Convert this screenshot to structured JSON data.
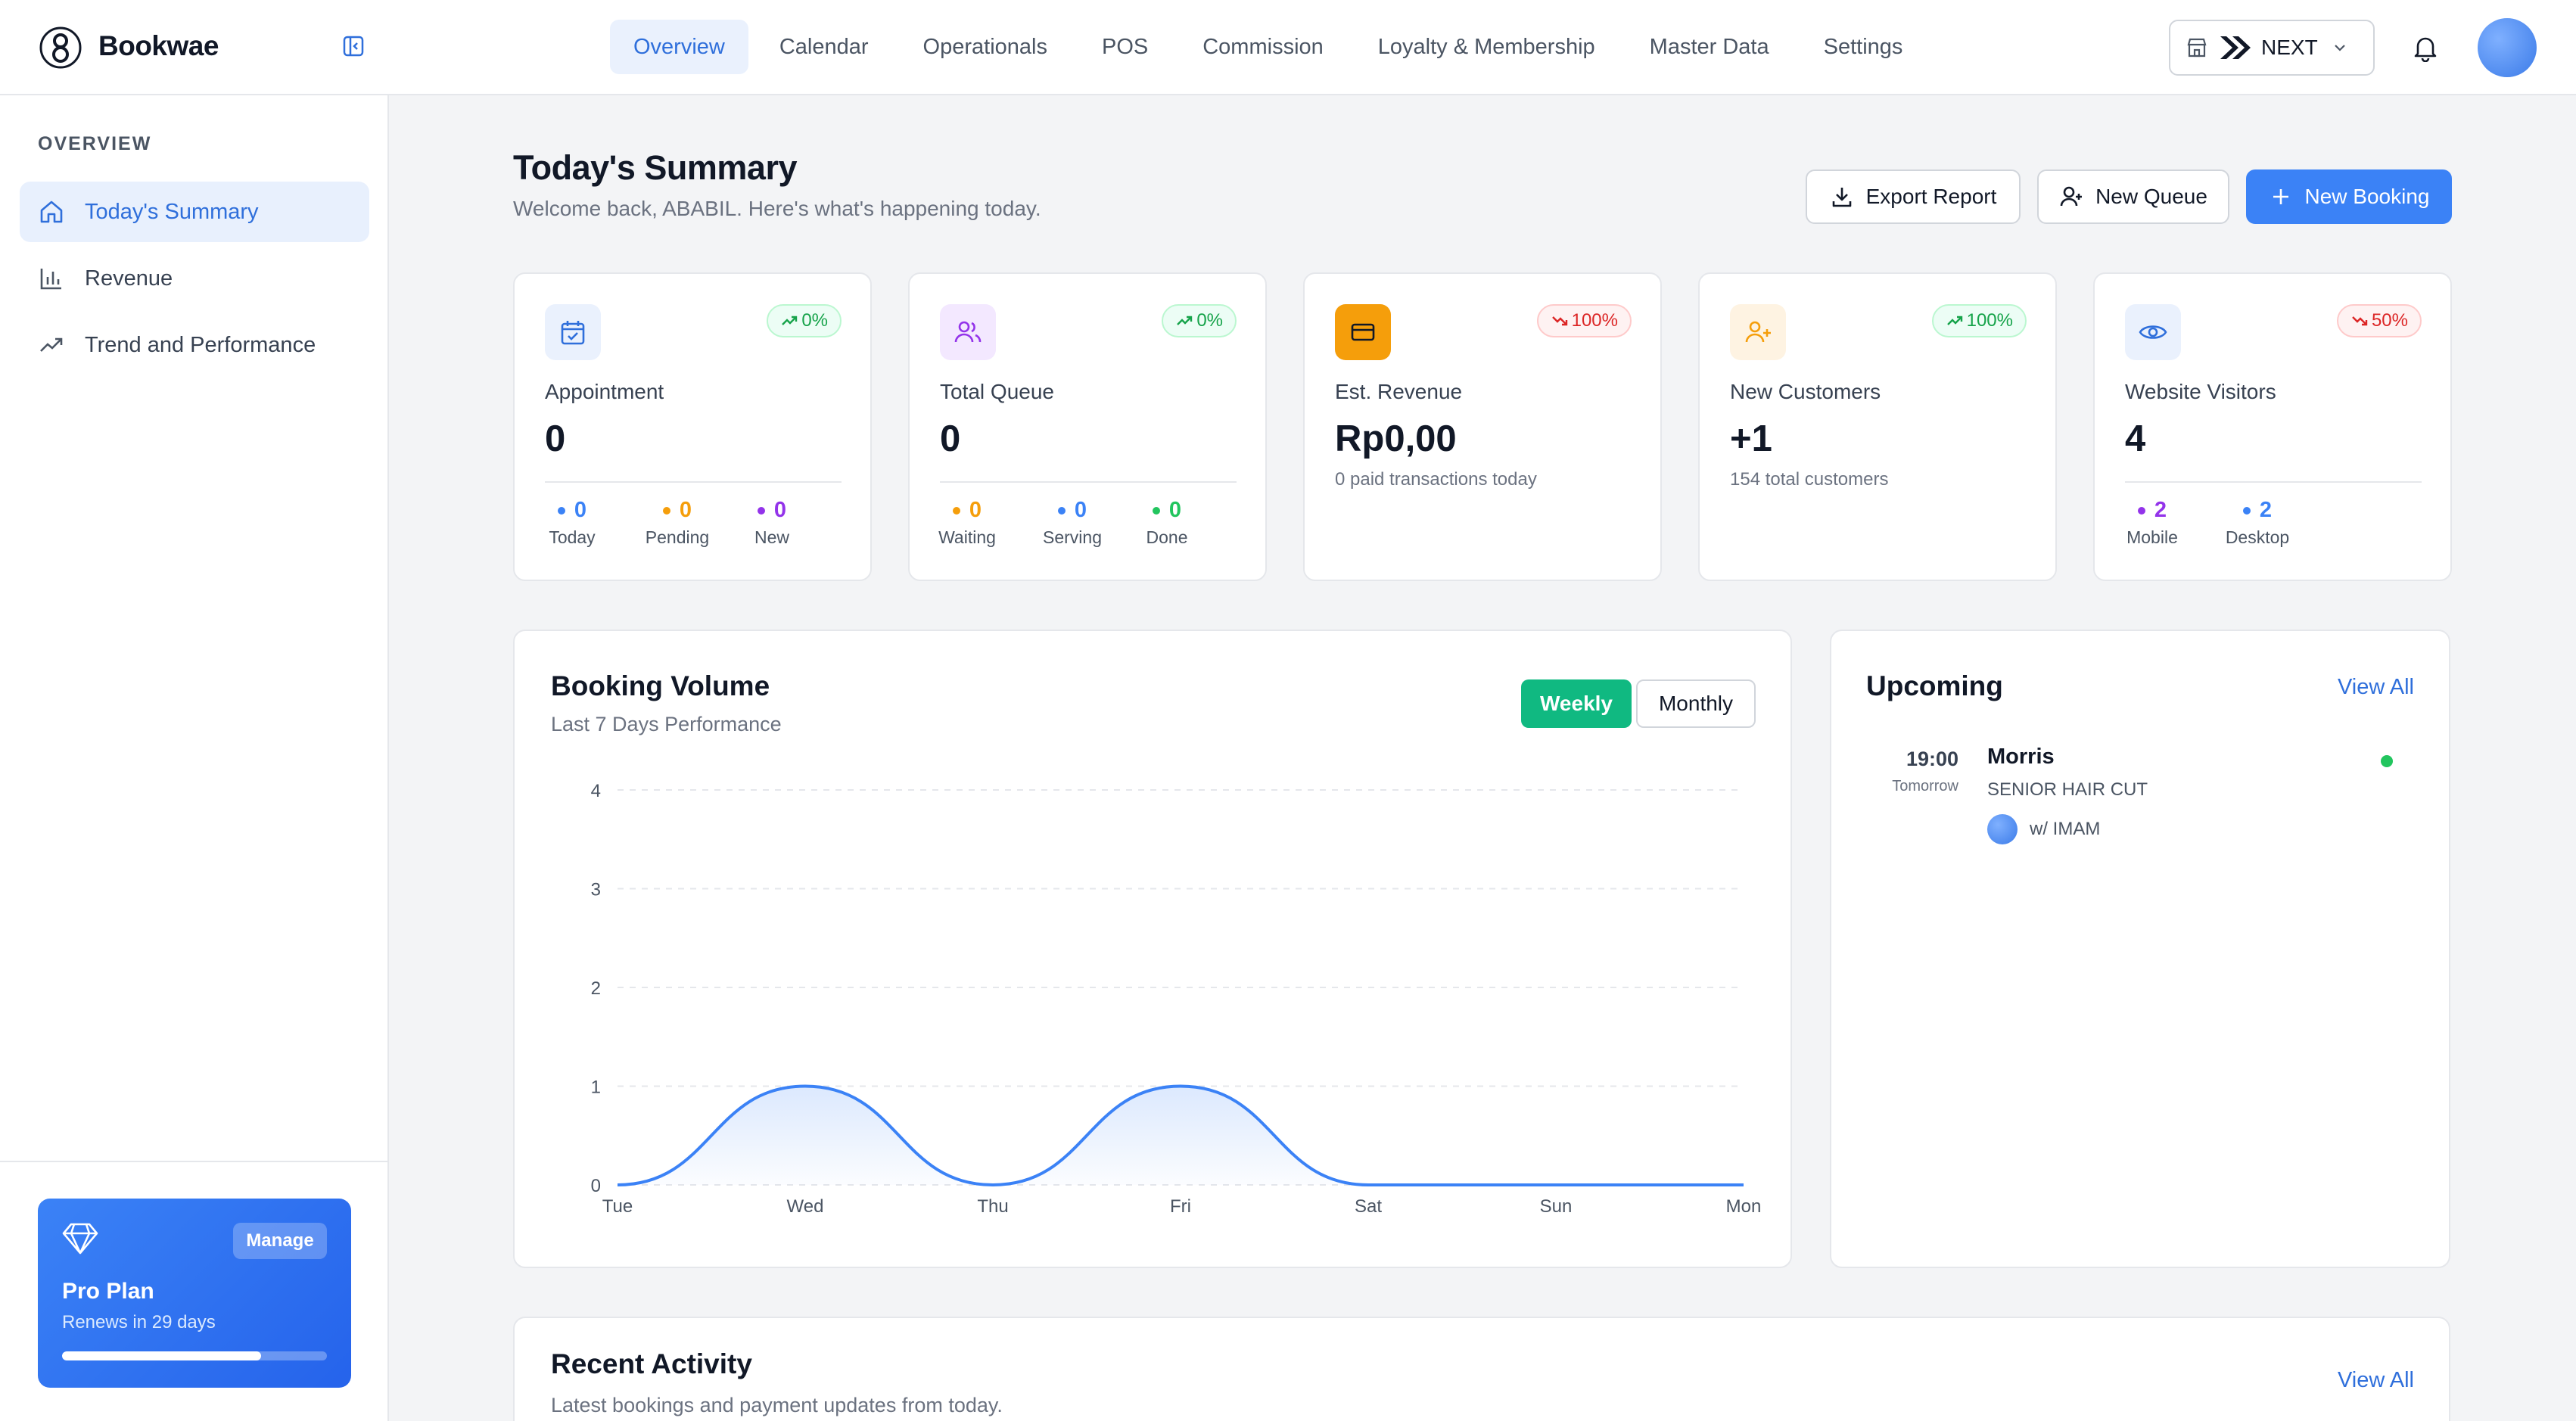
{
  "app": {
    "brand": "Bookwae"
  },
  "nav": {
    "items": [
      "Overview",
      "Calendar",
      "Operationals",
      "POS",
      "Commission",
      "Loyalty & Membership",
      "Master Data",
      "Settings"
    ],
    "active": "Overview"
  },
  "store_select": {
    "label": "NEXT"
  },
  "sidebar": {
    "section": "OVERVIEW",
    "items": [
      {
        "label": "Today's Summary",
        "icon": "home-icon",
        "active": true
      },
      {
        "label": "Revenue",
        "icon": "bar-chart-icon",
        "active": false
      },
      {
        "label": "Trend and Performance",
        "icon": "trending-up-icon",
        "active": false
      }
    ],
    "plan": {
      "name": "Pro Plan",
      "renews": "Renews in 29 days",
      "manage_label": "Manage",
      "progress": 0.75
    }
  },
  "header": {
    "title": "Today's Summary",
    "subtitle": "Welcome back, ABABIL. Here's what's happening today.",
    "export_label": "Export Report",
    "new_queue_label": "New Queue",
    "new_booking_label": "New Booking"
  },
  "stats": [
    {
      "label": "Appointment",
      "value": "0",
      "badge": "0%",
      "trend": "up",
      "subs": [
        {
          "value": "0",
          "caption": "Today",
          "color": "#3b82f6"
        },
        {
          "value": "0",
          "caption": "Pending",
          "color": "#f59e0b"
        },
        {
          "value": "0",
          "caption": "New",
          "color": "#9333ea"
        }
      ]
    },
    {
      "label": "Total Queue",
      "value": "0",
      "badge": "0%",
      "trend": "up",
      "subs": [
        {
          "value": "0",
          "caption": "Waiting",
          "color": "#f59e0b"
        },
        {
          "value": "0",
          "caption": "Serving",
          "color": "#3b82f6"
        },
        {
          "value": "0",
          "caption": "Done",
          "color": "#22c55e"
        }
      ]
    },
    {
      "label": "Est. Revenue",
      "value": "Rp0,00",
      "badge": "100%",
      "trend": "down",
      "note": "0 paid transactions today"
    },
    {
      "label": "New Customers",
      "value": "+1",
      "badge": "100%",
      "trend": "up",
      "note": "154 total customers"
    },
    {
      "label": "Website Visitors",
      "value": "4",
      "badge": "50%",
      "trend": "down",
      "subs": [
        {
          "value": "2",
          "caption": "Mobile",
          "color": "#9333ea"
        },
        {
          "value": "2",
          "caption": "Desktop",
          "color": "#3b82f6"
        }
      ]
    }
  ],
  "booking": {
    "title": "Booking Volume",
    "subtitle": "Last 7 Days Performance",
    "weekly_label": "Weekly",
    "monthly_label": "Monthly"
  },
  "chart_data": {
    "type": "area",
    "categories": [
      "Tue",
      "Wed",
      "Thu",
      "Fri",
      "Sat",
      "Sun",
      "Mon"
    ],
    "values": [
      0,
      1,
      0,
      1,
      0,
      0,
      0
    ],
    "ylim": [
      0,
      4
    ],
    "yticks": [
      "0",
      "1",
      "2",
      "3",
      "4"
    ],
    "grid": true,
    "color": "#3b82f6"
  },
  "upcoming": {
    "title": "Upcoming",
    "view_all": "View All",
    "items": [
      {
        "time": "19:00",
        "day": "Tomorrow",
        "name": "Morris",
        "service": "SENIOR HAIR CUT",
        "staff": "w/ IMAM",
        "status_color": "#22c55e"
      }
    ]
  },
  "recent": {
    "title": "Recent Activity",
    "subtitle": "Latest bookings and payment updates from today.",
    "view_all": "View All"
  }
}
